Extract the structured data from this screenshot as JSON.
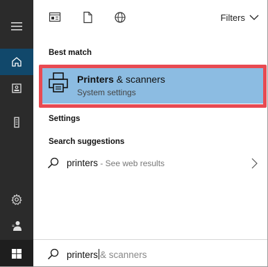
{
  "toolbar": {
    "filters_label": "Filters"
  },
  "sections": {
    "best_match": "Best match",
    "settings": "Settings",
    "search_suggestions": "Search suggestions"
  },
  "best_match_item": {
    "title_bold": "Printers",
    "title_rest": " & scanners",
    "subtitle": "System settings",
    "icon": "printer-icon"
  },
  "suggestion": {
    "query": "printers",
    "suffix": " - See web results"
  },
  "search": {
    "typed": "printers",
    "autocomplete": "& scanners"
  },
  "rail": {
    "icons": [
      "hamburger-menu-icon",
      "home-icon",
      "device-icon",
      "tower-icon",
      "gear-icon",
      "user-icon",
      "windows-start-icon"
    ]
  },
  "colors": {
    "rail_bg": "#2b2b2b",
    "rail_active": "#11486b",
    "selection_bg": "#8cbce2",
    "highlight_border": "#e84a52"
  }
}
